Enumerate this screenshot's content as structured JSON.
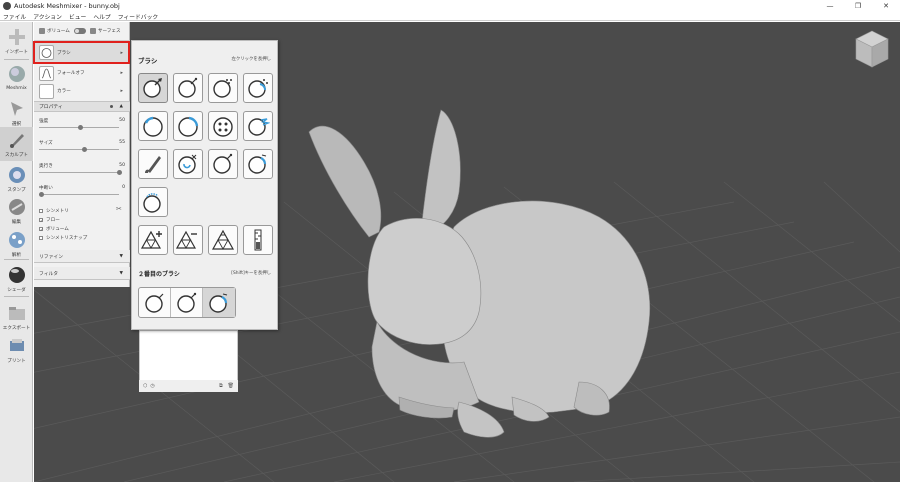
{
  "window": {
    "title": "Autodesk Meshmixer - bunny.obj",
    "controls": [
      "—",
      "❐",
      "✕"
    ]
  },
  "menu": [
    "ファイル",
    "アクション",
    "ビュー",
    "ヘルプ",
    "フィードバック"
  ],
  "toolbar": {
    "items": [
      {
        "label": "インポート",
        "icon": "plus-icon"
      },
      {
        "label": "Meshmix",
        "icon": "meshmix-sphere-icon"
      },
      {
        "label": "選択",
        "icon": "select-arrow-icon"
      },
      {
        "label": "スカルプト",
        "icon": "sculpt-brush-icon",
        "active": true
      },
      {
        "label": "スタンプ",
        "icon": "stamp-icon"
      },
      {
        "label": "編集",
        "icon": "edit-icon"
      },
      {
        "label": "解析",
        "icon": "analysis-icon"
      },
      {
        "label": "シェーダ",
        "icon": "shader-sphere-icon"
      },
      {
        "label": "エクスポート",
        "icon": "export-folder-icon"
      },
      {
        "label": "プリント",
        "icon": "print-icon"
      }
    ]
  },
  "sculpt_panel": {
    "mode_volume": "ボリューム",
    "mode_surface": "サーフェス",
    "brush_label": "ブラシ",
    "falloff_label": "フォールオフ",
    "color_label": "カラー",
    "properties_header": "プロパティ",
    "sliders": [
      {
        "name": "強度",
        "value": "50",
        "fraction": 0.5
      },
      {
        "name": "サイズ",
        "value": "55",
        "fraction": 0.55
      },
      {
        "name": "奥行き",
        "value": "50",
        "fraction": 1.0
      },
      {
        "name": "中断い",
        "value": "0",
        "fraction": 0.0
      }
    ],
    "checks": [
      {
        "label": "シンメトリ",
        "checked": false
      },
      {
        "label": "フロー",
        "checked": true
      },
      {
        "label": "ボリューム",
        "checked": true
      },
      {
        "label": "シンメトリスナップ",
        "checked": false
      }
    ],
    "refine_label": "リファイン",
    "filter_label": "フィルタ"
  },
  "brush_popup": {
    "title": "ブラシ",
    "hint": "左クリックを長押し",
    "secondary_title": "２番目のブラシ",
    "secondary_hint": "[Shift]キーを長押し"
  },
  "colors": {
    "viewport_bg": "#4b4b4b",
    "grid_line": "#5c5c5c",
    "highlight": "#e0211d",
    "accent_blue": "#3a9bd8"
  }
}
